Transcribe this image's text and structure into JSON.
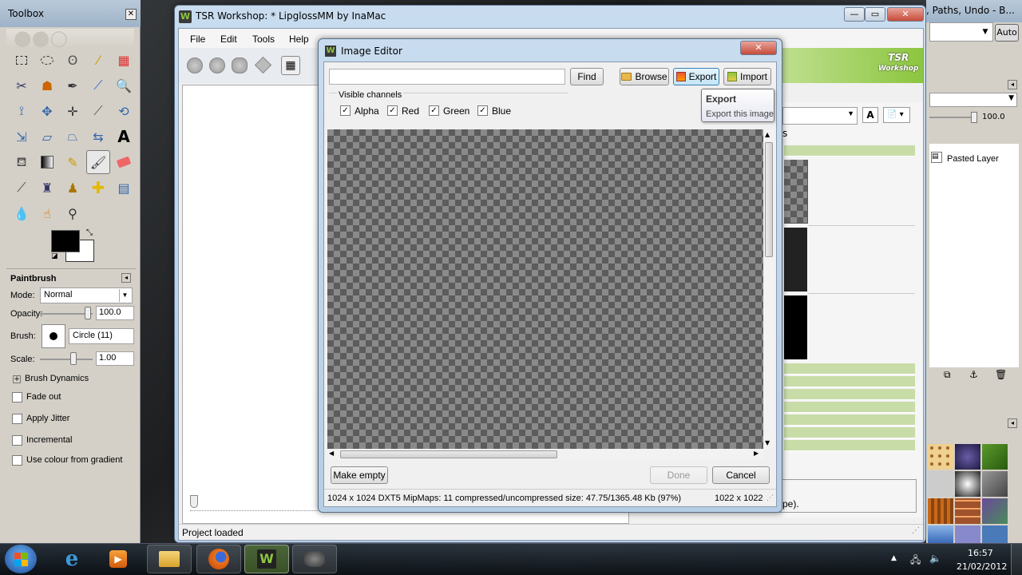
{
  "gimp_toolbox": {
    "title": "Toolbox",
    "tool_options_title": "Paintbrush",
    "mode_label": "Mode:",
    "mode_value": "Normal",
    "opacity_label": "Opacity:",
    "opacity_value": "100.0",
    "brush_label": "Brush:",
    "brush_value": "Circle (11)",
    "scale_label": "Scale:",
    "scale_value": "1.00",
    "brush_dynamics": "Brush Dynamics",
    "options": [
      "Fade out",
      "Apply Jitter",
      "Incremental",
      "Use colour from gradient"
    ]
  },
  "tsr_window": {
    "title": "TSR Workshop: * LipglossMM by InaMac",
    "menu": [
      "File",
      "Edit",
      "Tools",
      "Help"
    ],
    "status": "Project loaded",
    "partial_text": "pe).",
    "logo_line1": "TSR",
    "logo_line2": "Workshop",
    "partial_tab": "s"
  },
  "gimp_layers": {
    "title_partial": ", Paths, Undo - B...",
    "auto_label": "Auto",
    "opacity_value": "100.0",
    "layer_name": "Pasted Layer"
  },
  "image_editor": {
    "title": "Image Editor",
    "search_value": "",
    "find_label": "Find",
    "browse_label": "Browse",
    "export_label": "Export",
    "import_label": "Import",
    "tooltip_title": "Export",
    "tooltip_body": "Export this image",
    "channels_label": "Visible channels",
    "channels": [
      {
        "name": "Alpha",
        "checked": true
      },
      {
        "name": "Red",
        "checked": true
      },
      {
        "name": "Green",
        "checked": true
      },
      {
        "name": "Blue",
        "checked": true
      }
    ],
    "make_empty_label": "Make empty",
    "done_label": "Done",
    "cancel_label": "Cancel",
    "status_info": "1024 x 1024 DXT5 MipMaps: 11 compressed/uncompressed size: 47.75/1365.48 Kb (97%)",
    "status_dims": "1022 x 1022"
  },
  "taskbar": {
    "time": "16:57",
    "date": "21/02/2012"
  },
  "colors": {
    "tsr_green": "#8cc63f",
    "checker_dark": "#5c5c5c",
    "checker_light": "#8a8a8a",
    "title_blue": "#c9dcef"
  }
}
